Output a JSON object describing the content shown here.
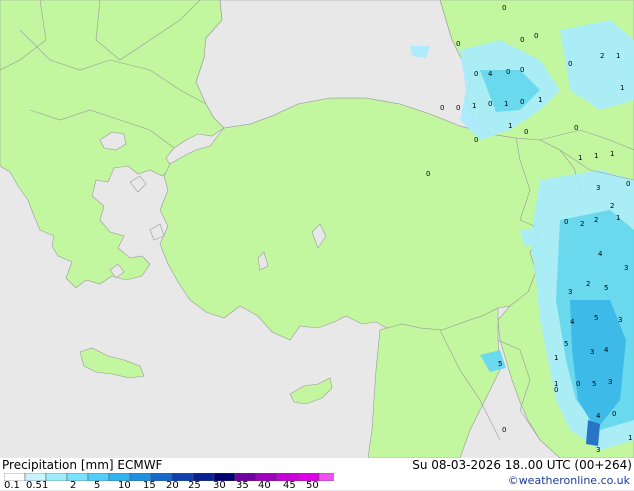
{
  "map": {
    "sea_color": "#e8e8e8",
    "land_color": "#c2f7a0",
    "border_color": "#9a9a9a",
    "precip_values": [
      {
        "label": "0"
      },
      {
        "label": "0"
      },
      {
        "label": "0"
      },
      {
        "label": "0"
      },
      {
        "label": "2"
      },
      {
        "label": "1"
      },
      {
        "label": "0"
      },
      {
        "label": "4"
      },
      {
        "label": "0"
      },
      {
        "label": "0"
      },
      {
        "label": "0"
      },
      {
        "label": "1"
      },
      {
        "label": "0"
      },
      {
        "label": "0"
      },
      {
        "label": "1"
      },
      {
        "label": "0"
      },
      {
        "label": "1"
      },
      {
        "label": "1"
      },
      {
        "label": "0"
      },
      {
        "label": "1"
      },
      {
        "label": "0"
      },
      {
        "label": "0"
      },
      {
        "label": "0"
      },
      {
        "label": "0"
      },
      {
        "label": "1"
      },
      {
        "label": "1"
      },
      {
        "label": "1"
      },
      {
        "label": "3"
      },
      {
        "label": "0"
      },
      {
        "label": "2"
      },
      {
        "label": "2"
      },
      {
        "label": "0"
      },
      {
        "label": "2"
      },
      {
        "label": "1"
      },
      {
        "label": "4"
      },
      {
        "label": "3"
      },
      {
        "label": "3"
      },
      {
        "label": "5"
      },
      {
        "label": "2"
      },
      {
        "label": "4"
      },
      {
        "label": "5"
      },
      {
        "label": "3"
      },
      {
        "label": "1"
      },
      {
        "label": "3"
      },
      {
        "label": "4"
      },
      {
        "label": "0"
      },
      {
        "label": "5"
      },
      {
        "label": "3"
      },
      {
        "label": "0"
      },
      {
        "label": "4"
      },
      {
        "label": "5"
      },
      {
        "label": "0"
      },
      {
        "label": "3"
      },
      {
        "label": "1"
      },
      {
        "label": "1"
      },
      {
        "label": "5"
      },
      {
        "label": "0"
      }
    ]
  },
  "footer": {
    "title": "Precipitation [mm]  ECMWF",
    "datetime": "Su 08-03-2026 18..00 UTC (00+264)",
    "credit": "©weatheronline.co.uk",
    "scale_colors": [
      "#ffffff",
      "#c8f4ff",
      "#a0ecff",
      "#78e2ff",
      "#50d0f8",
      "#30b4f0",
      "#2090e0",
      "#1868cc",
      "#1040b0",
      "#0a2090",
      "#000070",
      "#7000a0",
      "#a000c0",
      "#c800d8",
      "#e000e8",
      "#f050f0"
    ],
    "scale_labels": [
      "0.1",
      "0.5",
      "1",
      "2",
      "5",
      "10",
      "15",
      "20",
      "25",
      "30",
      "35",
      "40",
      "45",
      "50"
    ]
  }
}
